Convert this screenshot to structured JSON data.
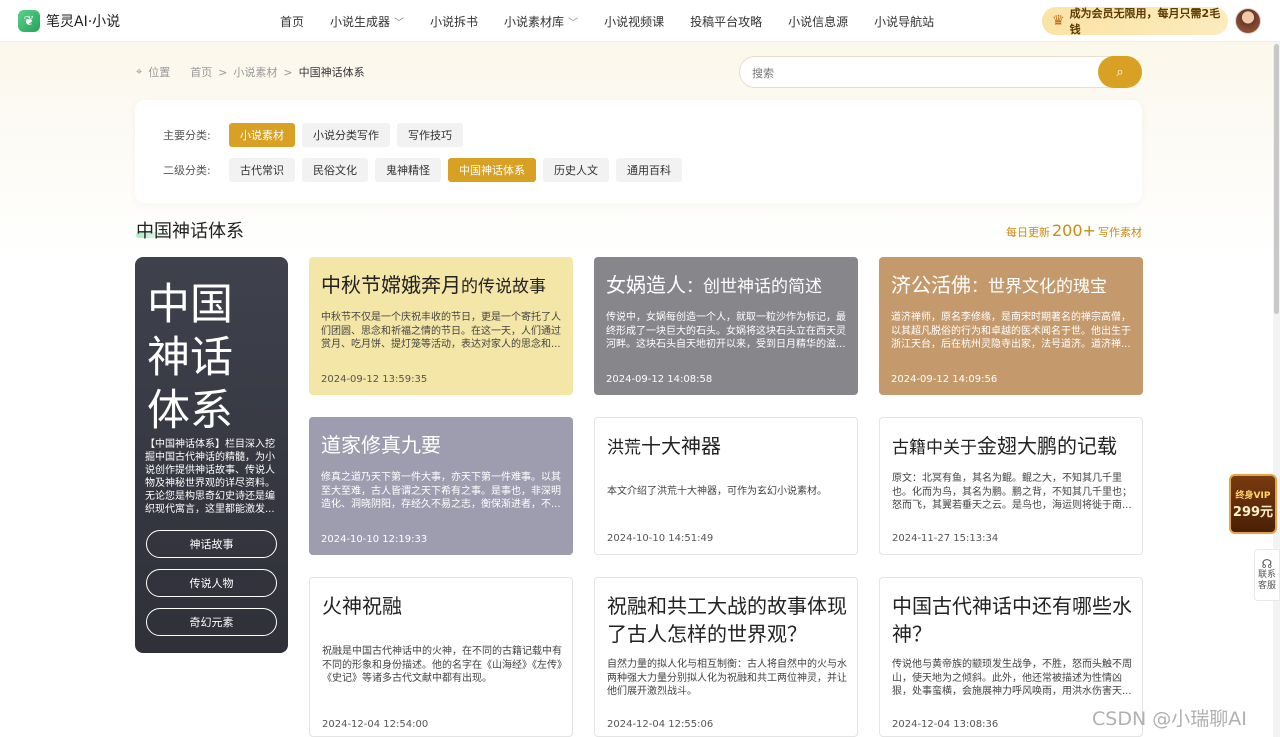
{
  "app": {
    "logo_icon": "leaf-logo-icon",
    "name": "笔灵AI·小说"
  },
  "nav": [
    {
      "label": "首页",
      "dropdown": false
    },
    {
      "label": "小说生成器",
      "dropdown": true
    },
    {
      "label": "小说拆书",
      "dropdown": false
    },
    {
      "label": "小说素材库",
      "dropdown": true
    },
    {
      "label": "小说视频课",
      "dropdown": false
    },
    {
      "label": "投稿平台攻略",
      "dropdown": false
    },
    {
      "label": "小说信息源",
      "dropdown": false
    },
    {
      "label": "小说导航站",
      "dropdown": false
    }
  ],
  "vip_banner": {
    "icon": "crown-icon",
    "text": "成为会员无限用，每月只需2毛钱"
  },
  "breadcrumb": {
    "location_label": "位置",
    "items": [
      "首页",
      "小说素材",
      "中国神话体系"
    ],
    "separator": ">"
  },
  "search": {
    "placeholder": "搜索",
    "value": ""
  },
  "filters": {
    "primary": {
      "label": "主要分类:",
      "tags": [
        {
          "label": "小说素材",
          "active": true
        },
        {
          "label": "小说分类写作",
          "active": false
        },
        {
          "label": "写作技巧",
          "active": false
        }
      ]
    },
    "secondary": {
      "label": "二级分类:",
      "tags": [
        {
          "label": "古代常识",
          "active": false
        },
        {
          "label": "民俗文化",
          "active": false
        },
        {
          "label": "鬼神精怪",
          "active": false
        },
        {
          "label": "中国神话体系",
          "active": true
        },
        {
          "label": "历史人文",
          "active": false
        },
        {
          "label": "通用百科",
          "active": false
        }
      ]
    }
  },
  "section": {
    "title": "中国神话体系",
    "update_prefix": "每日更新",
    "update_count": "200+",
    "update_suffix": "写作素材"
  },
  "sidebar": {
    "big_title_lines": [
      "中国",
      "神话",
      "体系"
    ],
    "description": "【中国神话体系】栏目深入挖掘中国古代神话的精髓，为小说创作提供神话故事、传说人物及神秘世界观的详尽资料。无论您是构思奇幻史诗还是编织现代寓言，这里都能激发...",
    "buttons": [
      "神话故事",
      "传说人物",
      "奇幻元素"
    ]
  },
  "cards": [
    {
      "title_main": "中秋节嫦娥奔月",
      "title_sub": "的传说故事",
      "desc": "中秋节不仅是一个庆祝丰收的节日，更是一个寄托了人们团圆、思念和祈福之情的节日。在这一天，人们通过赏月、吃月饼、提灯笼等活动，表达对家人的思念和...",
      "date": "2024-09-12 13:59:35",
      "bg": "#f3e6a6",
      "dark": false
    },
    {
      "title_main": "女娲造人",
      "title_sub": "：创世神话的简述",
      "desc": "传说中，女娲每创造一个人，就取一粒沙作为标记，最终形成了一块巨大的石头。女娲将这块石头立在西天灵河畔。这块石头自天地初开以来，受到日月精华的滋...",
      "date": "2024-09-12 14:08:58",
      "bg": "#87868b",
      "dark": true
    },
    {
      "title_main": "济公活佛",
      "title_sub": "：世界文化的瑰宝",
      "desc": "道济禅师，原名李修缘，是南宋时期著名的禅宗高僧，以其超凡脱俗的行为和卓越的医术闻名于世。他出生于浙江天台，后在杭州灵隐寺出家，法号道济。道济禅...",
      "date": "2024-09-12 14:09:56",
      "bg": "#c49a6c",
      "dark": true
    },
    {
      "title_main": "道家修真九要",
      "title_sub": "",
      "desc": "修真之道乃天下第一件大事，亦天下第一件难事。以其至大至难，古人皆谓之天下希有之事。是事也，非深明造化、洞晓阴阳，存经久不易之志，衡保渐进者，不...",
      "date": "2024-10-10 12:19:33",
      "bg": "#9d9daf",
      "dark": true
    },
    {
      "title_main": "十大神器",
      "title_sub": "洪荒",
      "desc": "本文介绍了洪荒十大神器，可作为玄幻小说素材。",
      "date": "2024-10-10 14:51:49",
      "bg": "#ffffff",
      "dark": false
    },
    {
      "title_main": "金翅大鹏的记载",
      "title_sub": "古籍中关于",
      "desc": "原文：北冥有鱼，其名为鲲。鲲之大，不知其几千里也。化而为鸟，其名为鹏。鹏之背，不知其几千里也；怒而飞，其翼若垂天之云。是鸟也，海运则将徙于南...",
      "date": "2024-11-27 15:13:34",
      "bg": "#ffffff",
      "dark": false
    },
    {
      "title_main": "火神祝融",
      "title_sub": "",
      "desc": "祝融是中国古代神话中的火神，在不同的古籍记载中有不同的形象和身份描述。他的名字在《山海经》《左传》《史记》等诸多古代文献中都有出现。",
      "date": "2024-12-04 12:54:00",
      "bg": "#ffffff",
      "dark": false
    },
    {
      "title_main": "祝融和共工大战的故事体现了古人怎样的世界观？",
      "title_sub": "",
      "desc": "自然力量的拟人化与相互制衡：古人将自然中的火与水两种强大力量分别拟人化为祝融和共工两位神灵，并让他们展开激烈战斗。",
      "date": "2024-12-04 12:55:06",
      "bg": "#ffffff",
      "dark": false
    },
    {
      "title_main": "中国古代神话中还有哪些水神？",
      "title_sub": "",
      "desc": "传说他与黄帝族的颛顼发生战争，不胜，怒而头触不周山，使天地为之倾斜。此外，他还常被描述为性情凶狠，处事蛮横，会施展神力呼风唤雨，用洪水伤害天...",
      "date": "2024-12-04 13:08:36",
      "bg": "#ffffff",
      "dark": false
    }
  ],
  "float_vip": {
    "line1": "终身VIP",
    "price": "299元"
  },
  "float_contact": {
    "icon": "headset-icon",
    "label": "联系客服"
  },
  "watermark": "CSDN @小瑞聊AI"
}
